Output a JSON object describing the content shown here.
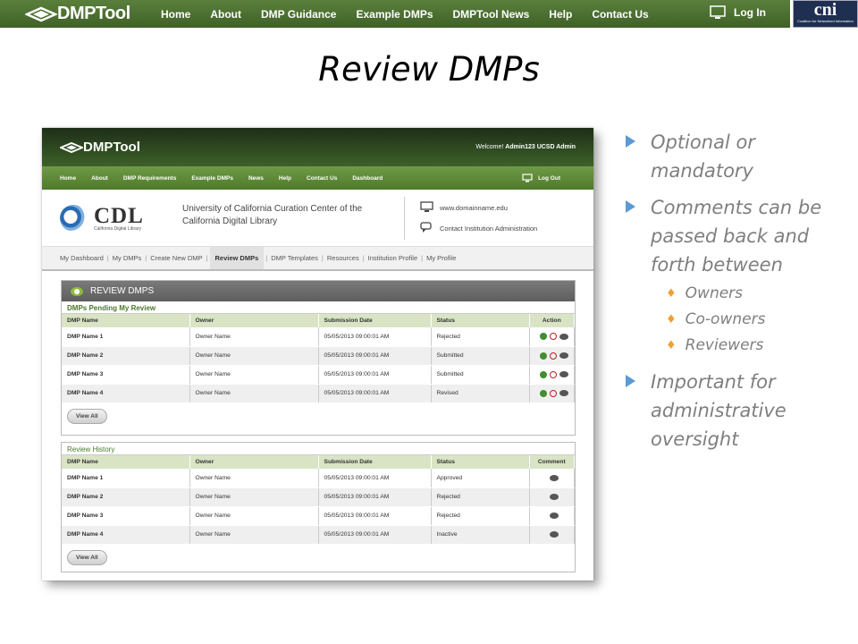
{
  "topbar": {
    "logo": "DMPTool",
    "nav": [
      "Home",
      "About",
      "DMP Guidance",
      "Example DMPs",
      "DMPTool News",
      "Help",
      "Contact Us"
    ],
    "login": "Log In",
    "cni": {
      "mark": "cni",
      "caption": "Coalition for Networked Information"
    }
  },
  "slide": {
    "title": "Review DMPs"
  },
  "screenshot": {
    "logo": "DMPTool",
    "welcome": {
      "prefix": "Welcome!",
      "user": "Admin123 UCSD Admin"
    },
    "nav": [
      "Home",
      "About",
      "DMP Requirements",
      "Example DMPs",
      "News",
      "Help",
      "Contact Us",
      "Dashboard"
    ],
    "logout": "Log Out",
    "institution": {
      "logo": "CDL",
      "logo_caption": "California Digital Library",
      "name": "University of California Curation Center of the California Digital Library",
      "url": "www.domainname.edu",
      "contact": "Contact Institution Administration"
    },
    "tabs": [
      "My Dashboard",
      "My DMPs",
      "Create New DMP",
      "Review DMPs",
      "DMP Templates",
      "Resources",
      "Institution Profile",
      "My Profile"
    ],
    "panel_title": "REVIEW DMPS",
    "pending": {
      "title": "DMPs Pending My Review",
      "headers": [
        "DMP Name",
        "Owner",
        "Submission Date",
        "Status",
        "Action"
      ],
      "rows": [
        {
          "name": "DMP Name 1",
          "owner": "Owner Name",
          "date": "05/05/2013 09:00:01 AM",
          "status": "Rejected"
        },
        {
          "name": "DMP Name 2",
          "owner": "Owner Name",
          "date": "05/05/2013 09:00:01 AM",
          "status": "Submitted"
        },
        {
          "name": "DMP Name 3",
          "owner": "Owner Name",
          "date": "05/05/2013 09:00:01 AM",
          "status": "Submitted"
        },
        {
          "name": "DMP Name 4",
          "owner": "Owner Name",
          "date": "05/05/2013 09:00:01 AM",
          "status": "Revised"
        }
      ]
    },
    "history": {
      "title": "Review History",
      "headers": [
        "DMP Name",
        "Owner",
        "Submission Date",
        "Status",
        "Comment"
      ],
      "rows": [
        {
          "name": "DMP Name 1",
          "owner": "Owner Name",
          "date": "05/05/2013 09:00:01 AM",
          "status": "Approved"
        },
        {
          "name": "DMP Name 2",
          "owner": "Owner Name",
          "date": "05/05/2013 09:00:01 AM",
          "status": "Rejected"
        },
        {
          "name": "DMP Name 3",
          "owner": "Owner Name",
          "date": "05/05/2013 09:00:01 AM",
          "status": "Rejected"
        },
        {
          "name": "DMP Name 4",
          "owner": "Owner Name",
          "date": "05/05/2013 09:00:01 AM",
          "status": "Inactive"
        }
      ]
    },
    "view_all": "View All"
  },
  "bullets": {
    "b1": "Optional or mandatory",
    "b2": "Comments can be passed back and forth between",
    "sub": [
      "Owners",
      "Co-owners",
      "Reviewers"
    ],
    "b3": "Important for administrative oversight"
  },
  "colors": {
    "accent_green": "#4e7a2c",
    "bullet_blue": "#5b9bd5",
    "sub_bullet_orange": "#f0a030"
  }
}
